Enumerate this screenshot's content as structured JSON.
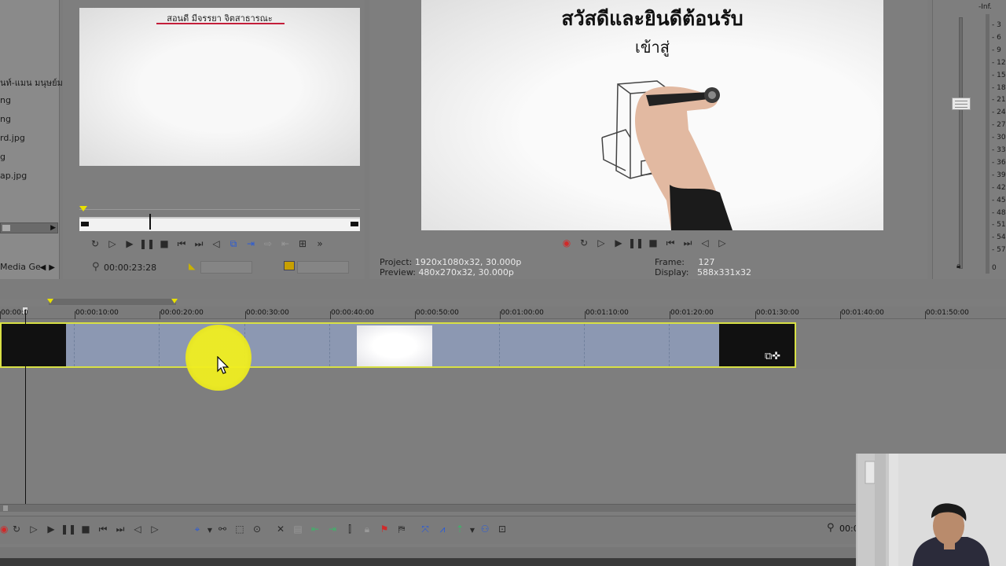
{
  "explorer": {
    "files": [
      "นท์-แมน มนุษย์ม",
      "ng",
      "ng",
      "rd.jpg",
      "g",
      "ap.jpg"
    ],
    "tab_label": "Media Ge"
  },
  "trimmer": {
    "caption": "สอนดี มีจรรยา จิตสาธารณะ",
    "time": "00:00:23:28",
    "controls": [
      "loop-icon",
      "play-from-start-icon",
      "play-icon",
      "pause-icon",
      "stop-icon",
      "prev-frame-icon",
      "next-frame-icon",
      "prev-icon",
      "create-region-icon",
      "add-to-timeline-icon",
      "insert-icon",
      "overwrite-icon",
      "fit-icon",
      "more-icon"
    ]
  },
  "preview": {
    "welcome": "สวัสดีและยินดีต้อนรับ",
    "welcome_sub": "เข้าสู่",
    "project_label": "Project:",
    "project_value": "1920x1080x32, 30.000p",
    "preview_label": "Preview:",
    "preview_value": "480x270x32, 30.000p",
    "frame_label": "Frame:",
    "frame_value": "127",
    "display_label": "Display:",
    "display_value": "588x331x32",
    "controls": [
      "record-icon",
      "loop-icon",
      "play-from-start-icon",
      "play-icon",
      "pause-icon",
      "stop-icon",
      "prev-frame-icon",
      "next-frame-icon",
      "prev-icon",
      "next-icon"
    ]
  },
  "meter": {
    "inf": "-Inf.",
    "ticks": [
      "3",
      "6",
      "9",
      "12",
      "15",
      "18",
      "21",
      "24",
      "27",
      "30",
      "33",
      "36",
      "39",
      "42",
      "45",
      "48",
      "51",
      "54",
      "57",
      "0"
    ],
    "master_level": 0.0
  },
  "timeline": {
    "ruler": [
      "00:00:0",
      "00:00:10:00",
      "00:00:20:00",
      "00:00:30:00",
      "00:00:40:00",
      "00:00:50:00",
      "00:01:00:00",
      "00:01:10:00",
      "00:01:20:00",
      "00:01:30:00",
      "00:01:40:00",
      "00:01:50:00"
    ]
  },
  "bottom": {
    "time_fragment": "00:0",
    "transport": [
      "record-icon",
      "loop-icon",
      "play-from-start-icon",
      "play-icon",
      "pause-icon",
      "stop-icon",
      "prev-icon",
      "next-icon",
      "prev-frame-icon",
      "next-frame-icon"
    ],
    "edit_tools": [
      "normal-edit-tool-icon",
      "dropdown-icon",
      "envelope-tool-icon",
      "selection-tool-icon",
      "zoom-tool-icon",
      "delete-icon",
      "trim-icon",
      "trim-start-icon",
      "trim-end-icon",
      "split-icon",
      "lock-icon",
      "marker-icon",
      "region-icon",
      "snapping-icon",
      "auto-crossfade-icon",
      "ripple-icon",
      "dropdown-icon",
      "lock-envelopes-icon",
      "ignore-grouping-icon"
    ]
  },
  "colors": {
    "clip_body": "#8c98b2",
    "clip_border": "#d8e045",
    "highlight": "#f0ee20",
    "record": "#d02a2a"
  }
}
